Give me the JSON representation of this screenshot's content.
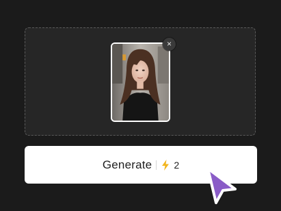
{
  "remove_button": {
    "glyph": "×"
  },
  "thumbnail": {
    "icon": "portrait-photo"
  },
  "generate_button": {
    "label": "Generate",
    "credit_icon": "lightning-bolt-icon",
    "credit_count": "2"
  },
  "colors": {
    "background": "#1b1b1b",
    "drop_zone": "#262626",
    "button": "#ffffff",
    "bolt": "#f2b51d",
    "cursor": "#8a5cc7"
  }
}
